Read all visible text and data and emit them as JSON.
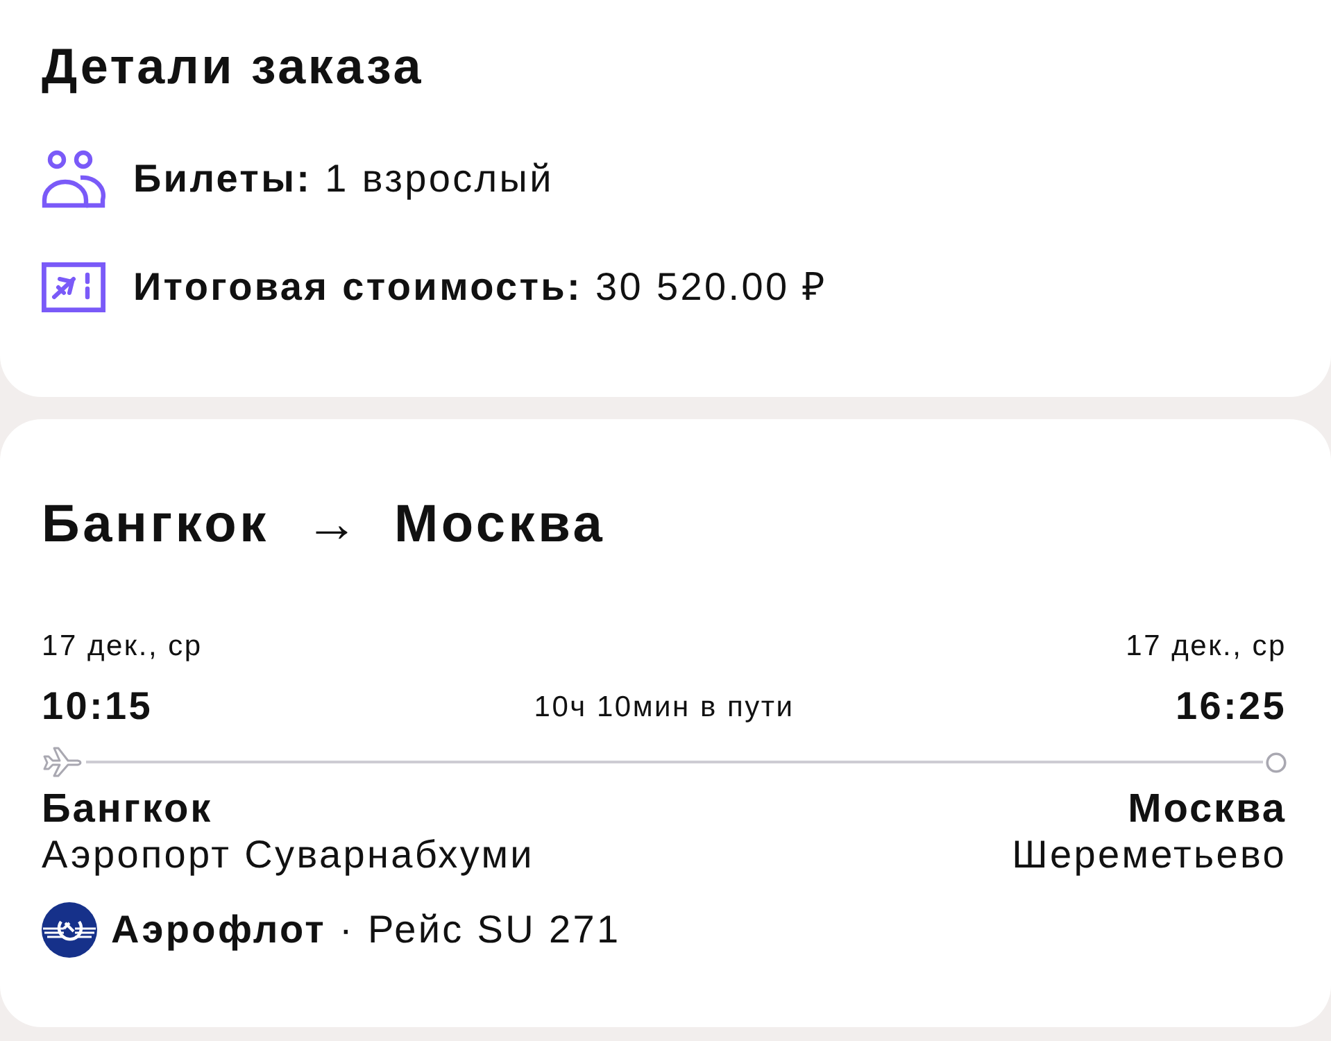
{
  "order_details": {
    "title": "Детали заказа",
    "items": [
      {
        "kind": "passengers",
        "text": "**Билеты:** 1 взрослый"
      },
      {
        "kind": "ticket",
        "text": "**Итоговая стоимость:** 30 520.00 ₽"
      }
    ]
  },
  "flight": {
    "route": {
      "from": "Бангкок",
      "arrow": "→",
      "to": "Москва"
    },
    "departure": {
      "date": "17 дек., ср",
      "time": "10:15",
      "city": "Бангкок",
      "airport": "Аэропорт Суварнабхуми"
    },
    "duration": "10ч 10мин в пути",
    "arrival": {
      "date": "17 дек., ср",
      "time": "16:25",
      "city": "Москва",
      "airport": "Шереметьево"
    },
    "airline": {
      "text": "**Аэрофлот** · Рейс SU 271"
    }
  }
}
